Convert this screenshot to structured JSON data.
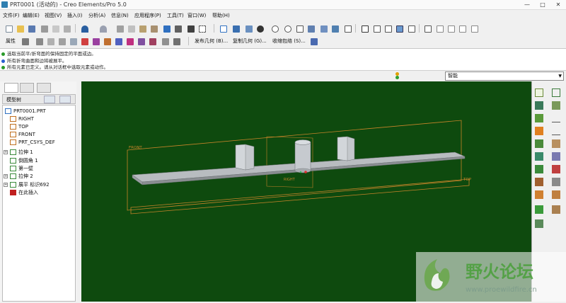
{
  "window": {
    "title": "PRT0001 (活动的) - Creo Elements/Pro 5.0",
    "minimize": "—",
    "maximize": "□",
    "close": "✕"
  },
  "menubar": {
    "items": [
      "文件(F)",
      "编辑(E)",
      "视图(V)",
      "插入(I)",
      "分析(A)",
      "信息(N)",
      "应用程序(P)",
      "工具(T)",
      "窗口(W)",
      "帮助(H)"
    ]
  },
  "toolbar2": {
    "properties_label": "属性",
    "publish_geom": "发布几何 (B)...",
    "copy_geom": "复制几何 (G)...",
    "shrinkwrap": "收缩包络 (S)..."
  },
  "messages": [
    {
      "text": "选取当前平/折弯面的保持固定的平面或边。",
      "color": "#2a9a2a"
    },
    {
      "text": "所有折弯曲面和边将被展平。",
      "color": "#2a5fd0"
    },
    {
      "text": "所有元素已定义。请从对话框中选取元素或动作。",
      "color": "#2a9a2a"
    }
  ],
  "filter": {
    "value": "智能"
  },
  "left_panel": {
    "header": "模型树",
    "tree": [
      {
        "label": "PRT0001.PRT",
        "icon": "part-icon",
        "expandable": false,
        "color": "#3070c0"
      },
      {
        "label": "RIGHT",
        "icon": "datum-plane-icon",
        "expandable": false,
        "color": "#c07020"
      },
      {
        "label": "TOP",
        "icon": "datum-plane-icon",
        "expandable": false,
        "color": "#c07020"
      },
      {
        "label": "FRONT",
        "icon": "datum-plane-icon",
        "expandable": false,
        "color": "#c07020"
      },
      {
        "label": "PRT_CSYS_DEF",
        "icon": "csys-icon",
        "expandable": false,
        "color": "#c07020"
      },
      {
        "label": "拉伸 1",
        "icon": "extrude-icon",
        "expandable": true,
        "color": "#3a8a3a"
      },
      {
        "label": "倒圆角 1",
        "icon": "round-icon",
        "expandable": false,
        "color": "#3a8a3a"
      },
      {
        "label": "第一壁",
        "icon": "wall-icon",
        "expandable": false,
        "color": "#3a8a3a"
      },
      {
        "label": "拉伸 2",
        "icon": "extrude-icon",
        "expandable": true,
        "color": "#3a8a3a"
      },
      {
        "label": "展平 标识692",
        "icon": "unbend-icon",
        "expandable": true,
        "color": "#3a8a3a"
      },
      {
        "label": "在此插入",
        "icon": "insert-here-icon",
        "expandable": false,
        "color": "#c02020"
      }
    ]
  },
  "viewport": {
    "background": "#0e4a0e",
    "datum_labels": {
      "front": "FRONT",
      "right": "RIGHT",
      "top": "TOP"
    }
  },
  "watermark": {
    "title": "野火论坛",
    "url": "www.proewildfire.cn"
  },
  "colors": {
    "datum": "#c8842a",
    "model_fill": "#b8bcc0",
    "model_edge": "#6a6e72"
  }
}
